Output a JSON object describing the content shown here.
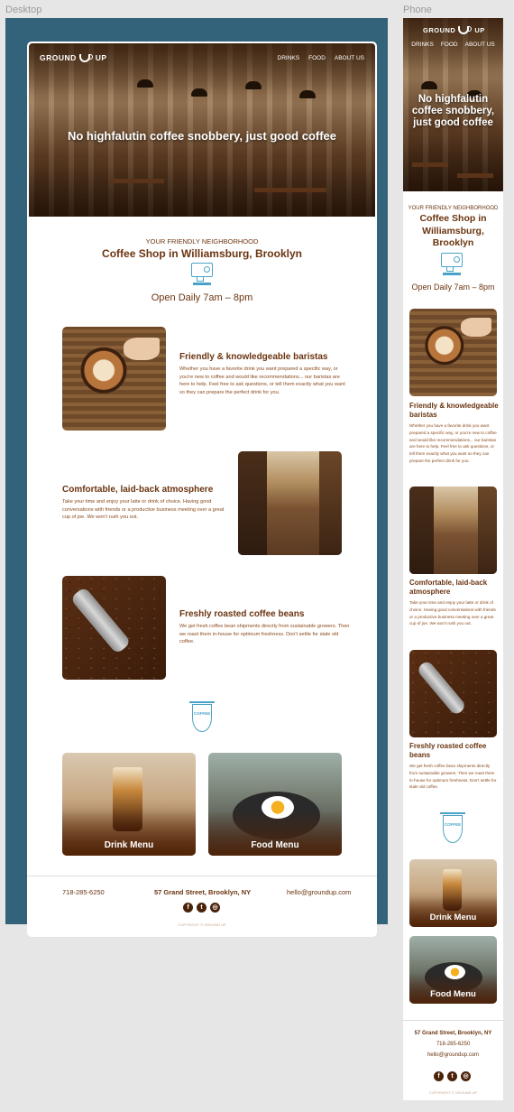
{
  "frames": {
    "desktop_label": "Desktop",
    "phone_label": "Phone"
  },
  "brand": {
    "logo_left": "GROUND",
    "logo_right": "UP"
  },
  "nav": {
    "drinks": "DRINKS",
    "food": "FOOD",
    "about": "ABOUT US"
  },
  "hero": {
    "title": "No highfalutin coffee snobbery, just good coffee"
  },
  "intro": {
    "subtitle": "YOUR FRIENDLY NEIGHBORHOOD",
    "title": "Coffee Shop in Williamsburg, Brooklyn",
    "hours": "Open Daily 7am – 8pm"
  },
  "features": [
    {
      "title": "Friendly & knowledgeable baristas",
      "body": "Whether you have a favorite drink you want prepared a specific way, or you're new to coffee and would like recommendations... our baristas are here to help. Feel free to ask questions, or tell them exactly what you want so they can prepare the perfect drink for you."
    },
    {
      "title": "Comfortable, laid-back atmosphere",
      "body": "Take your time and enjoy your latte or drink of choice. Having good conversations with friends or a productive business meeting over a great cup of joe. We won't rush you out."
    },
    {
      "title": "Freshly roasted coffee beans",
      "body": "We get fresh coffee bean shipments directly from sustainable growers. Then we roast them in-house for optimum freshness. Don't settle for stale old coffee."
    }
  ],
  "sign": {
    "line1": "COFFEE"
  },
  "menus": {
    "drink": "Drink Menu",
    "food": "Food Menu"
  },
  "footer": {
    "phone": "718-285-6250",
    "address": "57 Grand Street, Brooklyn, NY",
    "email": "hello@groundup.com",
    "copyright": "COPYRIGHT © GROUND UP"
  },
  "social": {
    "facebook": "f",
    "twitter": "t",
    "instagram": "◎"
  },
  "colors": {
    "brand_brown": "#6b3410",
    "frame_blue": "#33637a",
    "icon_blue": "#4aa3c7",
    "canvas": "#e6e6e6"
  }
}
